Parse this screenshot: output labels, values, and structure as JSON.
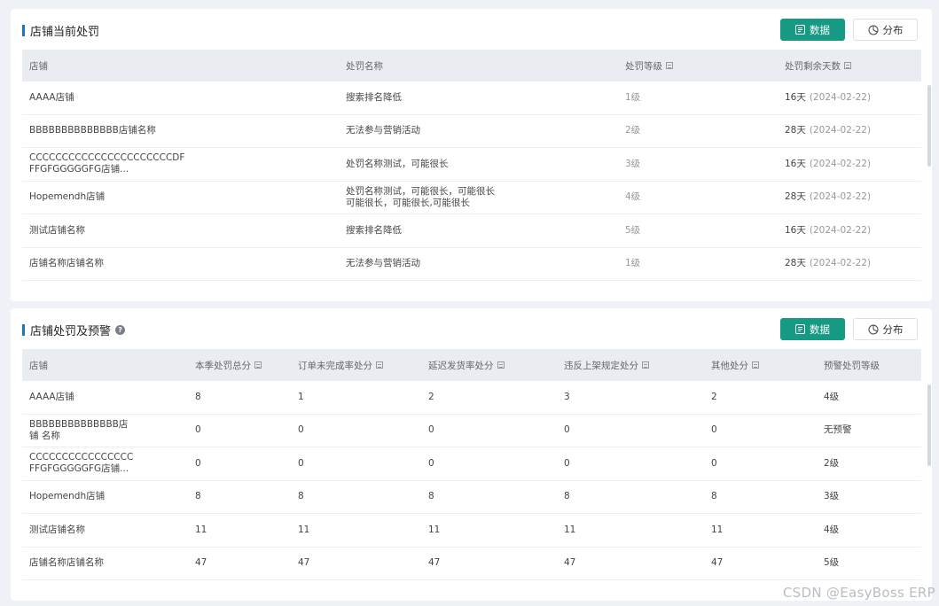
{
  "current_penalty": {
    "title": "店铺当前处罚",
    "btn_data": "数据",
    "btn_dist": "分布",
    "headers": [
      "店铺",
      "处罚名称",
      "处罚等级",
      "处罚剩余天数"
    ],
    "rows": [
      {
        "store": "AAAA店铺",
        "name": "搜索排名降低",
        "level": "1级",
        "days": "16天",
        "date": "(2024-02-22)"
      },
      {
        "store": "BBBBBBBBBBBBBB店铺名称",
        "name": "无法参与营销活动",
        "level": "2级",
        "days": "28天",
        "date": "(2024-02-22)"
      },
      {
        "store": "CCCCCCCCCCCCCCCCCCCCCCDF FFGFGGGGGFG店铺...",
        "name": "处罚名称测试，可能很长",
        "level": "3级",
        "days": "16天",
        "date": "(2024-02-22)"
      },
      {
        "store": "Hopemendh店铺",
        "name": "处罚名称测试，可能很长，可能很长 可能很长，可能很长,可能很长",
        "level": "4级",
        "days": "28天",
        "date": "(2024-02-22)"
      },
      {
        "store": "测试店铺名称",
        "name": "搜索排名降低",
        "level": "5级",
        "days": "16天",
        "date": "(2024-02-22)"
      },
      {
        "store": "店铺名称店铺名称",
        "name": "无法参与营销活动",
        "level": "1级",
        "days": "28天",
        "date": "(2024-02-22)"
      }
    ]
  },
  "warning": {
    "title": "店铺处罚及预警",
    "btn_data": "数据",
    "btn_dist": "分布",
    "headers": [
      "店铺",
      "本季处罚总分",
      "订单未完成率处分",
      "延迟发货率处分",
      "违反上架规定处分",
      "其他处分",
      "预警处罚等级"
    ],
    "rows": [
      {
        "store": "AAAA店铺",
        "total": "8",
        "unfinished": "1",
        "delay": "2",
        "listing": "3",
        "other": "2",
        "level": "4级"
      },
      {
        "store": "BBBBBBBBBBBBBB店铺 名称",
        "total": "0",
        "unfinished": "0",
        "delay": "0",
        "listing": "0",
        "other": "0",
        "level": "无预警"
      },
      {
        "store": "CCCCCCCCCCCCCCCC FFGFGGGGGFG店铺...",
        "total": "0",
        "unfinished": "0",
        "delay": "0",
        "listing": "0",
        "other": "0",
        "level": "2级"
      },
      {
        "store": "Hopemendh店铺",
        "total": "8",
        "unfinished": "8",
        "delay": "8",
        "listing": "8",
        "other": "8",
        "level": "3级"
      },
      {
        "store": "测试店铺名称",
        "total": "11",
        "unfinished": "11",
        "delay": "11",
        "listing": "11",
        "other": "11",
        "level": "4级"
      },
      {
        "store": "店铺名称店铺名称",
        "total": "47",
        "unfinished": "47",
        "delay": "47",
        "listing": "47",
        "other": "47",
        "level": "5级"
      }
    ]
  },
  "watermark": "CSDN @EasyBoss ERP",
  "colors": {
    "accent": "#179a84",
    "title_bar": "#1677c8",
    "header_bg": "#e9edf2"
  }
}
